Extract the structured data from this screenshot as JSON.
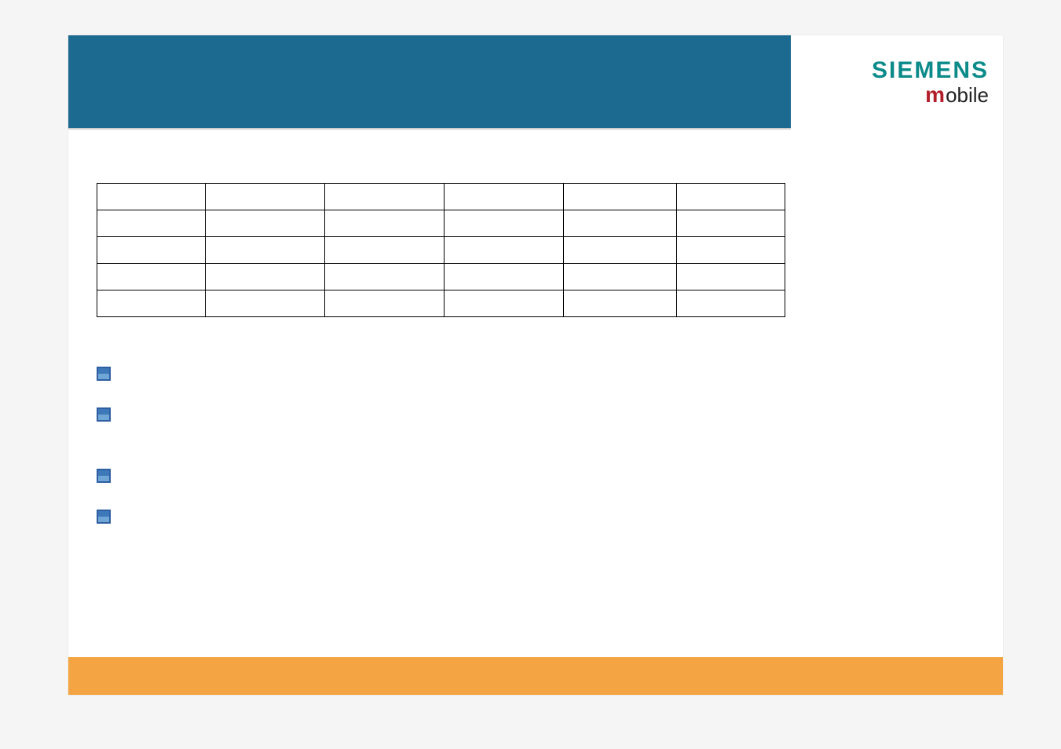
{
  "logo": {
    "siemens": "SIEMENS",
    "m": "m",
    "obile": "obile"
  },
  "table": {
    "headers": [
      "",
      "",
      "",
      "",
      "",
      ""
    ],
    "rows": [
      [
        "",
        "",
        "",
        "",
        "",
        ""
      ],
      [
        "",
        "",
        "",
        "",
        "",
        ""
      ],
      [
        "",
        "",
        "",
        "",
        "",
        ""
      ],
      [
        "",
        "",
        "",
        "",
        "",
        ""
      ]
    ]
  },
  "bullets": [
    "",
    "",
    "",
    ""
  ],
  "colors": {
    "header": "#1c6a8f",
    "footer": "#f4a442",
    "siemens_brand": "#0b8a8a",
    "mobile_m": "#b21e2a"
  }
}
